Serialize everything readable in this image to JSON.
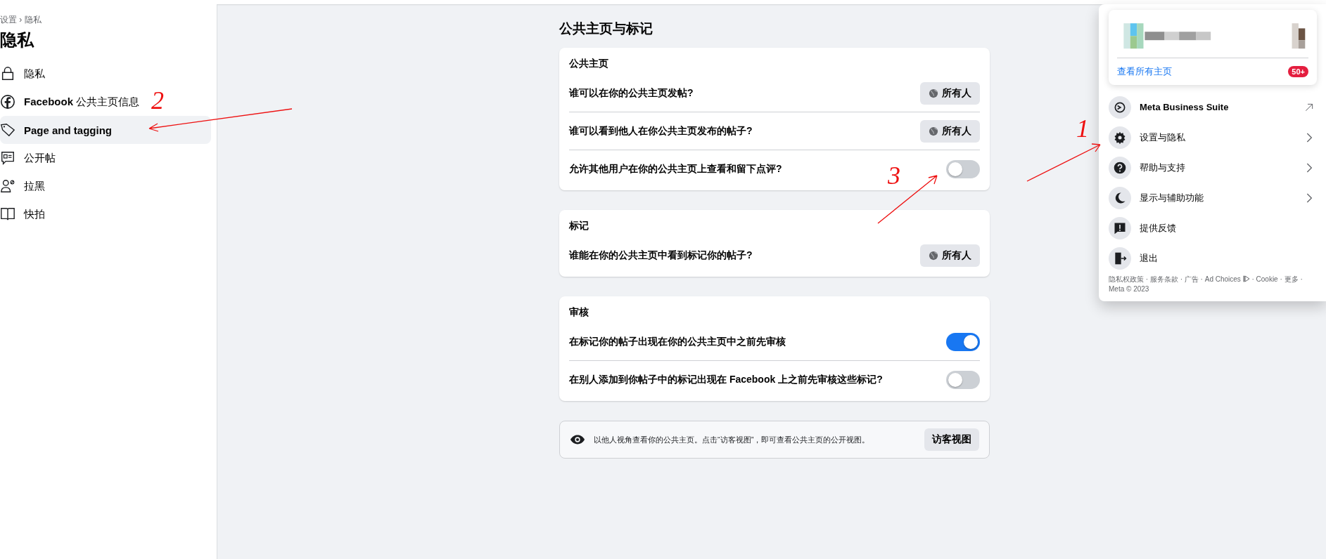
{
  "sidebar": {
    "breadcrumb": "设置 › 隐私",
    "title": "隐私",
    "items": [
      {
        "label": "隐私",
        "selected": false
      },
      {
        "label": "**Facebook** 公共主页信息",
        "selected": false
      },
      {
        "label": "Page and tagging",
        "selected": true
      },
      {
        "label": "公开帖",
        "selected": false
      },
      {
        "label": "拉黑",
        "selected": false
      },
      {
        "label": "快拍",
        "selected": false
      }
    ]
  },
  "main": {
    "title": "公共主页与标记",
    "sections": [
      {
        "title": "公共主页",
        "rows": [
          {
            "kind": "audience",
            "label": "谁可以在你的公共主页发帖?",
            "value": "所有人"
          },
          {
            "kind": "audience",
            "label": "谁可以看到他人在你公共主页发布的帖子?",
            "value": "所有人"
          },
          {
            "kind": "toggle",
            "label": "允许其他用户在你的公共主页上查看和留下点评?",
            "on": false
          }
        ]
      },
      {
        "title": "标记",
        "rows": [
          {
            "kind": "audience",
            "label": "谁能在你的公共主页中看到标记你的帖子?",
            "value": "所有人"
          }
        ]
      },
      {
        "title": "审核",
        "rows": [
          {
            "kind": "toggle",
            "label": "在标记你的帖子出现在你的公共主页中之前先审核",
            "on": true
          },
          {
            "kind": "toggle",
            "label": "在别人添加到你帖子中的标记出现在 Facebook 上之前先审核这些标记?",
            "on": false
          }
        ]
      }
    ],
    "info": {
      "text": "以他人视角查看你的公共主页。点击“访客视图”，即可查看公共主页的公开视图。",
      "button": "访客视图"
    }
  },
  "menu": {
    "see_all": "查看所有主页",
    "badge": "50+",
    "items": [
      {
        "label": "Meta Business Suite"
      },
      {
        "label": "设置与隐私"
      },
      {
        "label": "帮助与支持"
      },
      {
        "label": "显示与辅助功能"
      },
      {
        "label": "提供反馈"
      },
      {
        "label": "退出"
      }
    ],
    "footer_links": [
      "隐私权政策",
      "服务条款",
      "广告",
      "Ad Choices",
      "Cookie",
      "更多"
    ],
    "separator": "·",
    "copyright": "Meta © 2023"
  },
  "annotations": [
    {
      "label": "2"
    },
    {
      "label": "3"
    },
    {
      "label": "1"
    }
  ]
}
